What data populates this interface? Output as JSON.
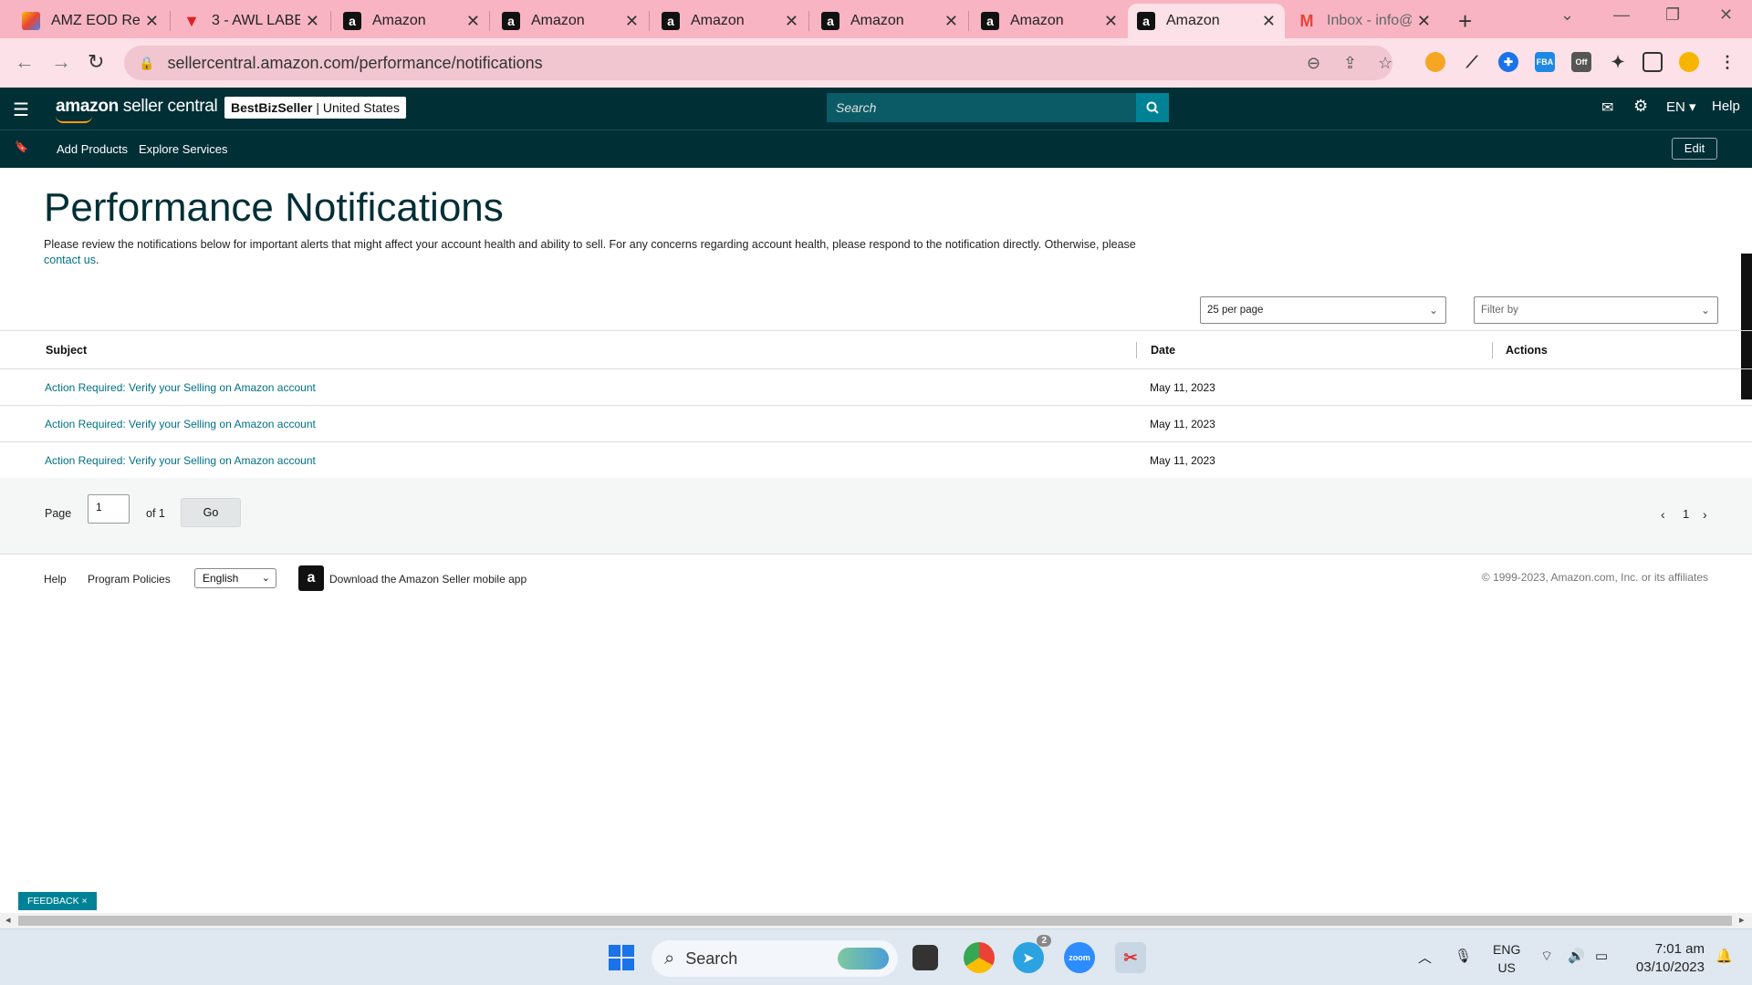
{
  "browser": {
    "tabs": [
      {
        "title": "AMZ EOD Re",
        "favicon": "pinwheel-icon",
        "color": "#e94235"
      },
      {
        "title": "3 - AWL LABE",
        "favicon": "v-logo-icon",
        "color": "#e02020"
      },
      {
        "title": "Amazon",
        "favicon": "amazon-a-icon",
        "color": "#111111"
      },
      {
        "title": "Amazon",
        "favicon": "amazon-a-icon",
        "color": "#111111"
      },
      {
        "title": "Amazon",
        "favicon": "amazon-a-icon",
        "color": "#111111"
      },
      {
        "title": "Amazon",
        "favicon": "amazon-a-icon",
        "color": "#111111"
      },
      {
        "title": "Amazon",
        "favicon": "amazon-a-icon",
        "color": "#111111"
      },
      {
        "title": "Amazon",
        "favicon": "amazon-a-icon",
        "color": "#111111",
        "active": true
      },
      {
        "title": "Inbox - info@",
        "favicon": "gmail-icon",
        "color": "#ea4335"
      }
    ],
    "url": "sellercentral.amazon.com/performance/notifications"
  },
  "header": {
    "logo_bold": "amazon",
    "logo_rest": " seller central",
    "store_name": "BestBizSeller",
    "store_sep": " | ",
    "store_region": "United States",
    "search_placeholder": "Search",
    "language": "EN",
    "help": "Help"
  },
  "subnav": {
    "items": [
      "Add Products",
      "Explore Services"
    ],
    "edit_label": "Edit"
  },
  "main": {
    "title": "Performance Notifications",
    "intro": "Please review the notifications below for important alerts that might affect your account health and ability to sell. For any concerns regarding account health, please respond to the notification directly. Otherwise, please",
    "contact_link": "contact us",
    "intro_end": ".",
    "per_page": "25 per page",
    "filter_placeholder": "Filter by",
    "columns": [
      "Subject",
      "Date",
      "Actions"
    ],
    "rows": [
      {
        "subject": "Action Required: Verify your Selling on Amazon account",
        "date": "May 11, 2023"
      },
      {
        "subject": "Action Required: Verify your Selling on Amazon account",
        "date": "May 11, 2023"
      },
      {
        "subject": "Action Required: Verify your Selling on Amazon account",
        "date": "May 11, 2023"
      }
    ],
    "pager": {
      "page_label": "Page",
      "page_value": "1",
      "of_label": "of 1",
      "go_label": "Go",
      "current_page": "1"
    }
  },
  "footer": {
    "help": "Help",
    "policies": "Program Policies",
    "language": "English",
    "app_text": "Download the Amazon Seller mobile app",
    "copyright": "© 1999-2023, Amazon.com, Inc. or its affiliates"
  },
  "feedback": "FEEDBACK ×",
  "taskbar": {
    "search": "Search",
    "telegram_badge": "2",
    "lang_top": "ENG",
    "lang_bottom": "US",
    "time": "7:01 am",
    "date": "03/10/2023"
  },
  "colors": {
    "header_bg": "#002f36",
    "link": "#007185",
    "tab_strip": "#f8b4c3"
  }
}
